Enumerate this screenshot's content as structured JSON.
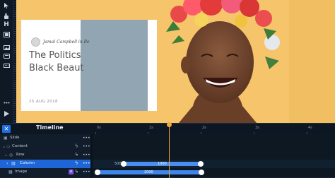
{
  "toolbar": {
    "tools": [
      "arrow-icon",
      "hand-icon",
      "heading-icon",
      "layers-icon",
      "image-icon",
      "scroll-icon",
      "keyboard-icon",
      "more-icon",
      "play-icon"
    ],
    "heading_glyph": "H"
  },
  "canvas": {
    "card": {
      "author": "Jamal Campbell in Be",
      "title_line1": "The Politics",
      "title_line2": "Black Beaut",
      "date": "25 AUG 2018"
    },
    "colors": {
      "background": "#f6c46b",
      "image_panel": "#92a5b3"
    }
  },
  "timeline": {
    "close_glyph": "✕",
    "title": "Timeline",
    "ticks": [
      "0s",
      "1s",
      "2s",
      "3s",
      "4s"
    ],
    "rows": [
      {
        "label": "Slide",
        "selected": false,
        "bolt": false
      },
      {
        "label": "Content",
        "selected": false,
        "bolt": true
      },
      {
        "label": "Row",
        "selected": false,
        "bolt": true
      },
      {
        "label": "Column",
        "selected": true,
        "bolt": true
      },
      {
        "label": "Image",
        "selected": false,
        "bolt": false
      }
    ],
    "column_bar": {
      "start_value": "500",
      "end_value": "1000"
    },
    "image_bar": {
      "value": "2000"
    },
    "image_badge": "A"
  }
}
